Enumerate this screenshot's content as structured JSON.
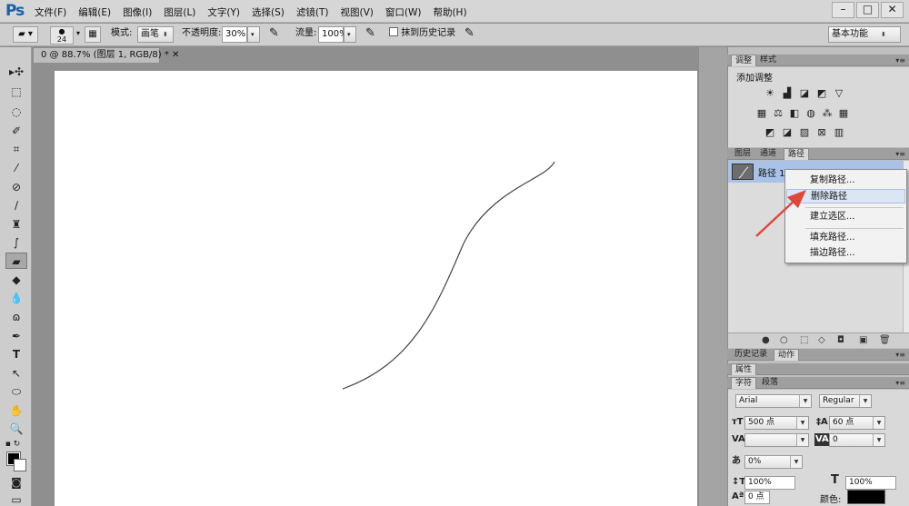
{
  "app": {
    "logo": "Ps"
  },
  "menu": [
    "文件(F)",
    "编辑(E)",
    "图像(I)",
    "图层(L)",
    "文字(Y)",
    "选择(S)",
    "滤镜(T)",
    "视图(V)",
    "窗口(W)",
    "帮助(H)"
  ],
  "window_controls": {
    "minimize": "–",
    "restore": "□",
    "close": "✕"
  },
  "options": {
    "brush_size": "24",
    "mode_label": "模式:",
    "mode_value": "画笔",
    "opacity_label": "不透明度:",
    "opacity_value": "30%",
    "flow_label": "流量:",
    "flow_value": "100%",
    "erase_history_label": "抹到历史记录",
    "workspace": "基本功能"
  },
  "document": {
    "tab_title": "0 @ 88.7% (图层 1, RGB/8) *"
  },
  "panels": {
    "adjust_tabs": [
      "调整",
      "样式"
    ],
    "adjust_title": "添加调整",
    "layer_tabs": [
      "图层",
      "通道",
      "路径"
    ],
    "path_name": "路径 1",
    "history_tabs": [
      "历史记录",
      "动作"
    ],
    "properties_tab": "属性",
    "char_tabs": [
      "字符",
      "段落"
    ]
  },
  "context_menu": {
    "items": [
      "复制路径...",
      "删除路径",
      "建立选区...",
      "填充路径...",
      "描边路径..."
    ]
  },
  "character": {
    "font_family": "Arial",
    "font_style": "Regular",
    "font_size": "500 点",
    "leading": "60 点",
    "tracking": "0",
    "scale_h": "0%",
    "vertical_scale": "100%",
    "horizontal_scale": "100%",
    "baseline": "0 点",
    "color_label": "颜色:"
  },
  "colors": {
    "accent": "#1b5fa8",
    "path_selected": "#a9c3e8",
    "arrow": "#e0463c"
  }
}
